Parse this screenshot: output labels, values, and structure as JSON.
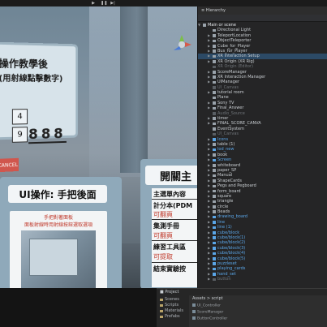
{
  "scene": {
    "top_panel": {
      "title": "操作教學後",
      "subtitle": "(用射線點擊數字)",
      "keys": [
        "4",
        "9"
      ],
      "digits": "888",
      "cancel": "CANCEL"
    },
    "left_panel": {
      "header": "UI操作: 手把後面",
      "caption_line1": "手把對著面板",
      "caption_line2": "面板射線時用射線按鈕選取選項"
    },
    "right_panel": {
      "header": "開關主",
      "lines": [
        "主選單內容",
        "計分本(PDM",
        "可翻頁",
        "集測手冊",
        "可翻頁",
        "練習工具區",
        "可提取",
        "結束實驗按"
      ]
    }
  },
  "hierarchy": {
    "tab": "≡ Hierarchy",
    "items": [
      {
        "label": "Main or scene",
        "level": 0,
        "style": "bold",
        "arrow": "▼"
      },
      {
        "label": "Directional Light",
        "level": 1,
        "style": "normal",
        "arrow": ""
      },
      {
        "label": "TeleportLocation",
        "level": 1,
        "style": "normal",
        "arrow": "▶"
      },
      {
        "label": "ObjectTeleporter",
        "level": 1,
        "style": "normal",
        "arrow": "▶"
      },
      {
        "label": "Cube_for_Player",
        "level": 1,
        "style": "normal",
        "arrow": "▶"
      },
      {
        "label": "Bus_for_Player",
        "level": 1,
        "style": "normal",
        "arrow": "▶"
      },
      {
        "label": "XR Interaction Setup",
        "level": 1,
        "style": "selected",
        "arrow": "▶"
      },
      {
        "label": "XR Origin (XR Rig)",
        "level": 1,
        "style": "normal",
        "arrow": "▶"
      },
      {
        "label": "XR Origin (Editor)",
        "level": 1,
        "style": "grey",
        "arrow": ""
      },
      {
        "label": "ScoreManager",
        "level": 1,
        "style": "normal",
        "arrow": "▶"
      },
      {
        "label": "XR Interaction Manager",
        "level": 1,
        "style": "normal",
        "arrow": "▶"
      },
      {
        "label": "UIManager",
        "level": 1,
        "style": "normal",
        "arrow": "▶"
      },
      {
        "label": "UI_Canvas",
        "level": 1,
        "style": "grey",
        "arrow": ""
      },
      {
        "label": "tutorial room",
        "level": 1,
        "style": "normal",
        "arrow": "▶"
      },
      {
        "label": "Plane",
        "level": 1,
        "style": "normal",
        "arrow": ""
      },
      {
        "label": "Sony TV",
        "level": 1,
        "style": "normal",
        "arrow": "▶"
      },
      {
        "label": "Final_Answer",
        "level": 1,
        "style": "normal",
        "arrow": "▶"
      },
      {
        "label": "Audio_Source",
        "level": 1,
        "style": "grey",
        "arrow": ""
      },
      {
        "label": "timer",
        "level": 1,
        "style": "normal",
        "arrow": "▶"
      },
      {
        "label": "FINAL_SCORE_CANVA",
        "level": 1,
        "style": "normal",
        "arrow": "▶"
      },
      {
        "label": "EventSystem",
        "level": 1,
        "style": "normal",
        "arrow": ""
      },
      {
        "label": "UI_Canvas",
        "level": 1,
        "style": "grey",
        "arrow": ""
      },
      {
        "label": "Icons",
        "level": 1,
        "style": "blue",
        "arrow": "▶"
      },
      {
        "label": "table (1)",
        "level": 1,
        "style": "normal",
        "arrow": "▶"
      },
      {
        "label": "lod_new",
        "level": 1,
        "style": "blue",
        "arrow": "▶"
      },
      {
        "label": "book",
        "level": 1,
        "style": "normal",
        "arrow": "▶"
      },
      {
        "label": "Screen",
        "level": 1,
        "style": "blue",
        "arrow": "▶"
      },
      {
        "label": "whiteboard",
        "level": 1,
        "style": "normal",
        "arrow": "▶"
      },
      {
        "label": "paper_SP",
        "level": 1,
        "style": "normal",
        "arrow": "▶"
      },
      {
        "label": "Manual",
        "level": 1,
        "style": "normal",
        "arrow": "▶"
      },
      {
        "label": "ShapeCards",
        "level": 1,
        "style": "normal",
        "arrow": "▶"
      },
      {
        "label": "Pegs and Pegboard",
        "level": 1,
        "style": "normal",
        "arrow": "▶"
      },
      {
        "label": "form_board",
        "level": 1,
        "style": "normal",
        "arrow": "▶"
      },
      {
        "label": "square",
        "level": 1,
        "style": "normal",
        "arrow": "▶"
      },
      {
        "label": "triangle",
        "level": 1,
        "style": "normal",
        "arrow": "▶"
      },
      {
        "label": "circle",
        "level": 1,
        "style": "normal",
        "arrow": "▶"
      },
      {
        "label": "Beads",
        "level": 1,
        "style": "normal",
        "arrow": "▶"
      },
      {
        "label": "drawing_board",
        "level": 1,
        "style": "blue",
        "arrow": "▶"
      },
      {
        "label": "line",
        "level": 1,
        "style": "blue",
        "arrow": "▶"
      },
      {
        "label": "line (1)",
        "level": 1,
        "style": "blue",
        "arrow": "▶"
      },
      {
        "label": "cube/block",
        "level": 1,
        "style": "blue",
        "arrow": "▶"
      },
      {
        "label": "cube/block(1)",
        "level": 1,
        "style": "blue",
        "arrow": "▶"
      },
      {
        "label": "cube/block(2)",
        "level": 1,
        "style": "blue",
        "arrow": "▶"
      },
      {
        "label": "cube/block(3)",
        "level": 1,
        "style": "blue",
        "arrow": "▶"
      },
      {
        "label": "cube/block(4)",
        "level": 1,
        "style": "blue",
        "arrow": "▶"
      },
      {
        "label": "cube/block(5)",
        "level": 1,
        "style": "blue",
        "arrow": "▶"
      },
      {
        "label": "puzzleset",
        "level": 1,
        "style": "blue",
        "arrow": "▶"
      },
      {
        "label": "playing_cards",
        "level": 1,
        "style": "blue",
        "arrow": "▶"
      },
      {
        "label": "hand_set",
        "level": 1,
        "style": "blue",
        "arrow": "▶"
      },
      {
        "label": "button",
        "level": 1,
        "style": "grey",
        "arrow": "▶"
      }
    ]
  },
  "project": {
    "tab": "■ Project",
    "tree": [
      "Scenes",
      "Scripts",
      "Materials",
      "Prefabs"
    ],
    "breadcrumb": "Assets > script",
    "assets": [
      "UI_Controller",
      "ScoreManager",
      "ButtonController"
    ]
  },
  "toolbar": {
    "play": "▶",
    "pause": "❚❚",
    "step": "▶|"
  }
}
